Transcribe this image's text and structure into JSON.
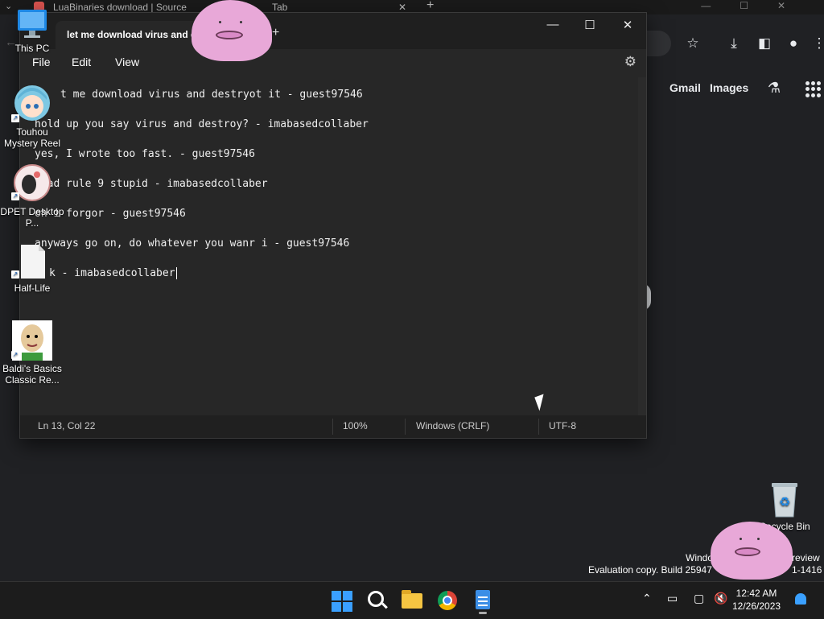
{
  "browser": {
    "tab_title": "LuaBinaries download | Source",
    "tab_suffix": "Tab",
    "tab_close": "✕",
    "new_tab": "+",
    "links": [
      "Gmail",
      "Images"
    ]
  },
  "notepad": {
    "tab_title": "let me download virus and d",
    "new_tab": "+",
    "controls": {
      "minimize": "—",
      "maximize": "☐",
      "close": "✕"
    },
    "menu": [
      "File",
      "Edit",
      "View"
    ],
    "lines": [
      "t me download virus and destryot it - guest97546",
      "hold up you say virus and destroy? - imabasedcollaber",
      "yes, I wrote too fast. - guest97546",
      "read rule 9 stupid - imabasedcollaber",
      "oh i forgor - guest97546",
      "anyways go on, do whatever you wanr i - guest97546",
      "k - imabasedcollaber"
    ],
    "status": {
      "position": "Ln 13, Col 22",
      "zoom": "100%",
      "line_ending": "Windows (CRLF)",
      "encoding": "UTF-8"
    }
  },
  "desktop": {
    "icons": [
      {
        "label": "This PC",
        "icon": "monitor-icon"
      },
      {
        "label": "Touhou Mystery Reel",
        "icon": "anime-girl-icon"
      },
      {
        "label": "DPET Desktop P...",
        "icon": "dpet-icon"
      },
      {
        "label": "Half-Life",
        "icon": "blank-file-icon"
      },
      {
        "label": "Baldi's Basics Classic Re...",
        "icon": "baldi-icon"
      },
      {
        "label": "Recycle Bin",
        "icon": "recycle-bin-icon"
      }
    ],
    "watermark": {
      "line1_a": "Windo",
      "line1_b": "Preview",
      "line2": "Evaluation copy. Build 25947",
      "line2_b": "1-1416"
    }
  },
  "taskbar": {
    "apps": [
      "start-icon",
      "search-icon",
      "file-explorer-icon",
      "chrome-icon",
      "notepad-icon"
    ],
    "time": "12:42 AM",
    "date": "12/26/2023"
  },
  "colors": {
    "accent": "#3aa0ff",
    "ditto": "#e8a8d8"
  }
}
